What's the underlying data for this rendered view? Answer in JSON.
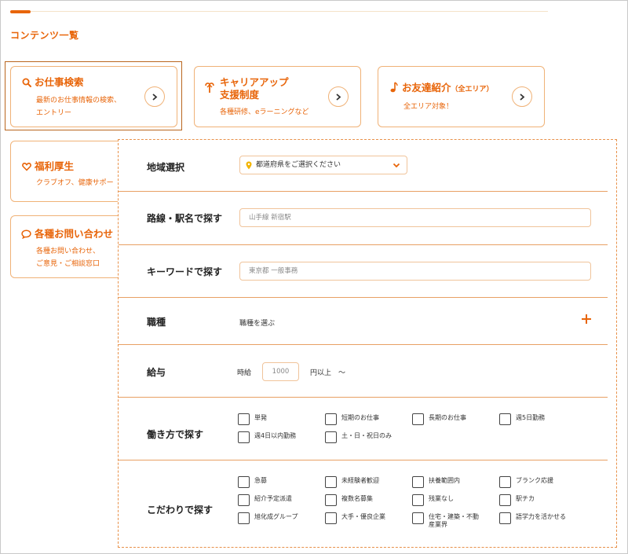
{
  "header": {
    "section_title": "コンテンツ一覧"
  },
  "cards": [
    {
      "id": "job-search",
      "icon": "search-icon",
      "title": "お仕事検索",
      "desc1": "最新のお仕事情報の検索、",
      "desc2": "エントリー"
    },
    {
      "id": "career-up",
      "icon": "career-up-icon",
      "title1": "キャリアアップ",
      "title2": "支援制度",
      "desc1": "各種研修、eラーニングなど"
    },
    {
      "id": "friend-referral",
      "icon": "music-note-icon",
      "title": "お友達紹介",
      "title_small": "（全エリア）",
      "desc1": "全エリア対象！"
    },
    {
      "id": "welfare",
      "icon": "heart-icon",
      "title": "福利厚生",
      "desc1": "クラブオフ、健康サポー"
    },
    {
      "id": "inquiry",
      "icon": "chat-bubble-icon",
      "title": "各種お問い合わせ",
      "desc1": "各種お問い合わせ、",
      "desc2": "ご意見・ご相談窓口"
    }
  ],
  "search_panel": {
    "region": {
      "label": "地域選択",
      "select_value": "都道府県をご選択ください"
    },
    "station": {
      "label": "路線・駅名で探す",
      "placeholder": "山手線 新宿駅"
    },
    "keyword": {
      "label": "キーワードで探す",
      "placeholder": "東京都 一般事務"
    },
    "job_type": {
      "label": "職種",
      "value": "職種を選ぶ"
    },
    "salary": {
      "label": "給与",
      "prefix": "時給",
      "placeholder": "1000",
      "suffix": "円以上　〜"
    },
    "work_style": {
      "label": "働き方で探す",
      "options": [
        "単発",
        "短期のお仕事",
        "長期のお仕事",
        "週5日勤務",
        "週4日以内勤務",
        "土・日・祝日のみ"
      ]
    },
    "preferences": {
      "label": "こだわりで探す",
      "options": [
        "急募",
        "未経験者歓迎",
        "扶養範囲内",
        "ブランク応援",
        "紹介予定派遣",
        "複数名募集",
        "残業なし",
        "駅チカ",
        "旭化成グループ",
        "大手・優良企業",
        "住宅・建築・不動産業界",
        "語学力を活かせる"
      ]
    }
  },
  "colors": {
    "accent": "#e8650a",
    "border": "#f0b277",
    "pin": "#f2b400"
  }
}
